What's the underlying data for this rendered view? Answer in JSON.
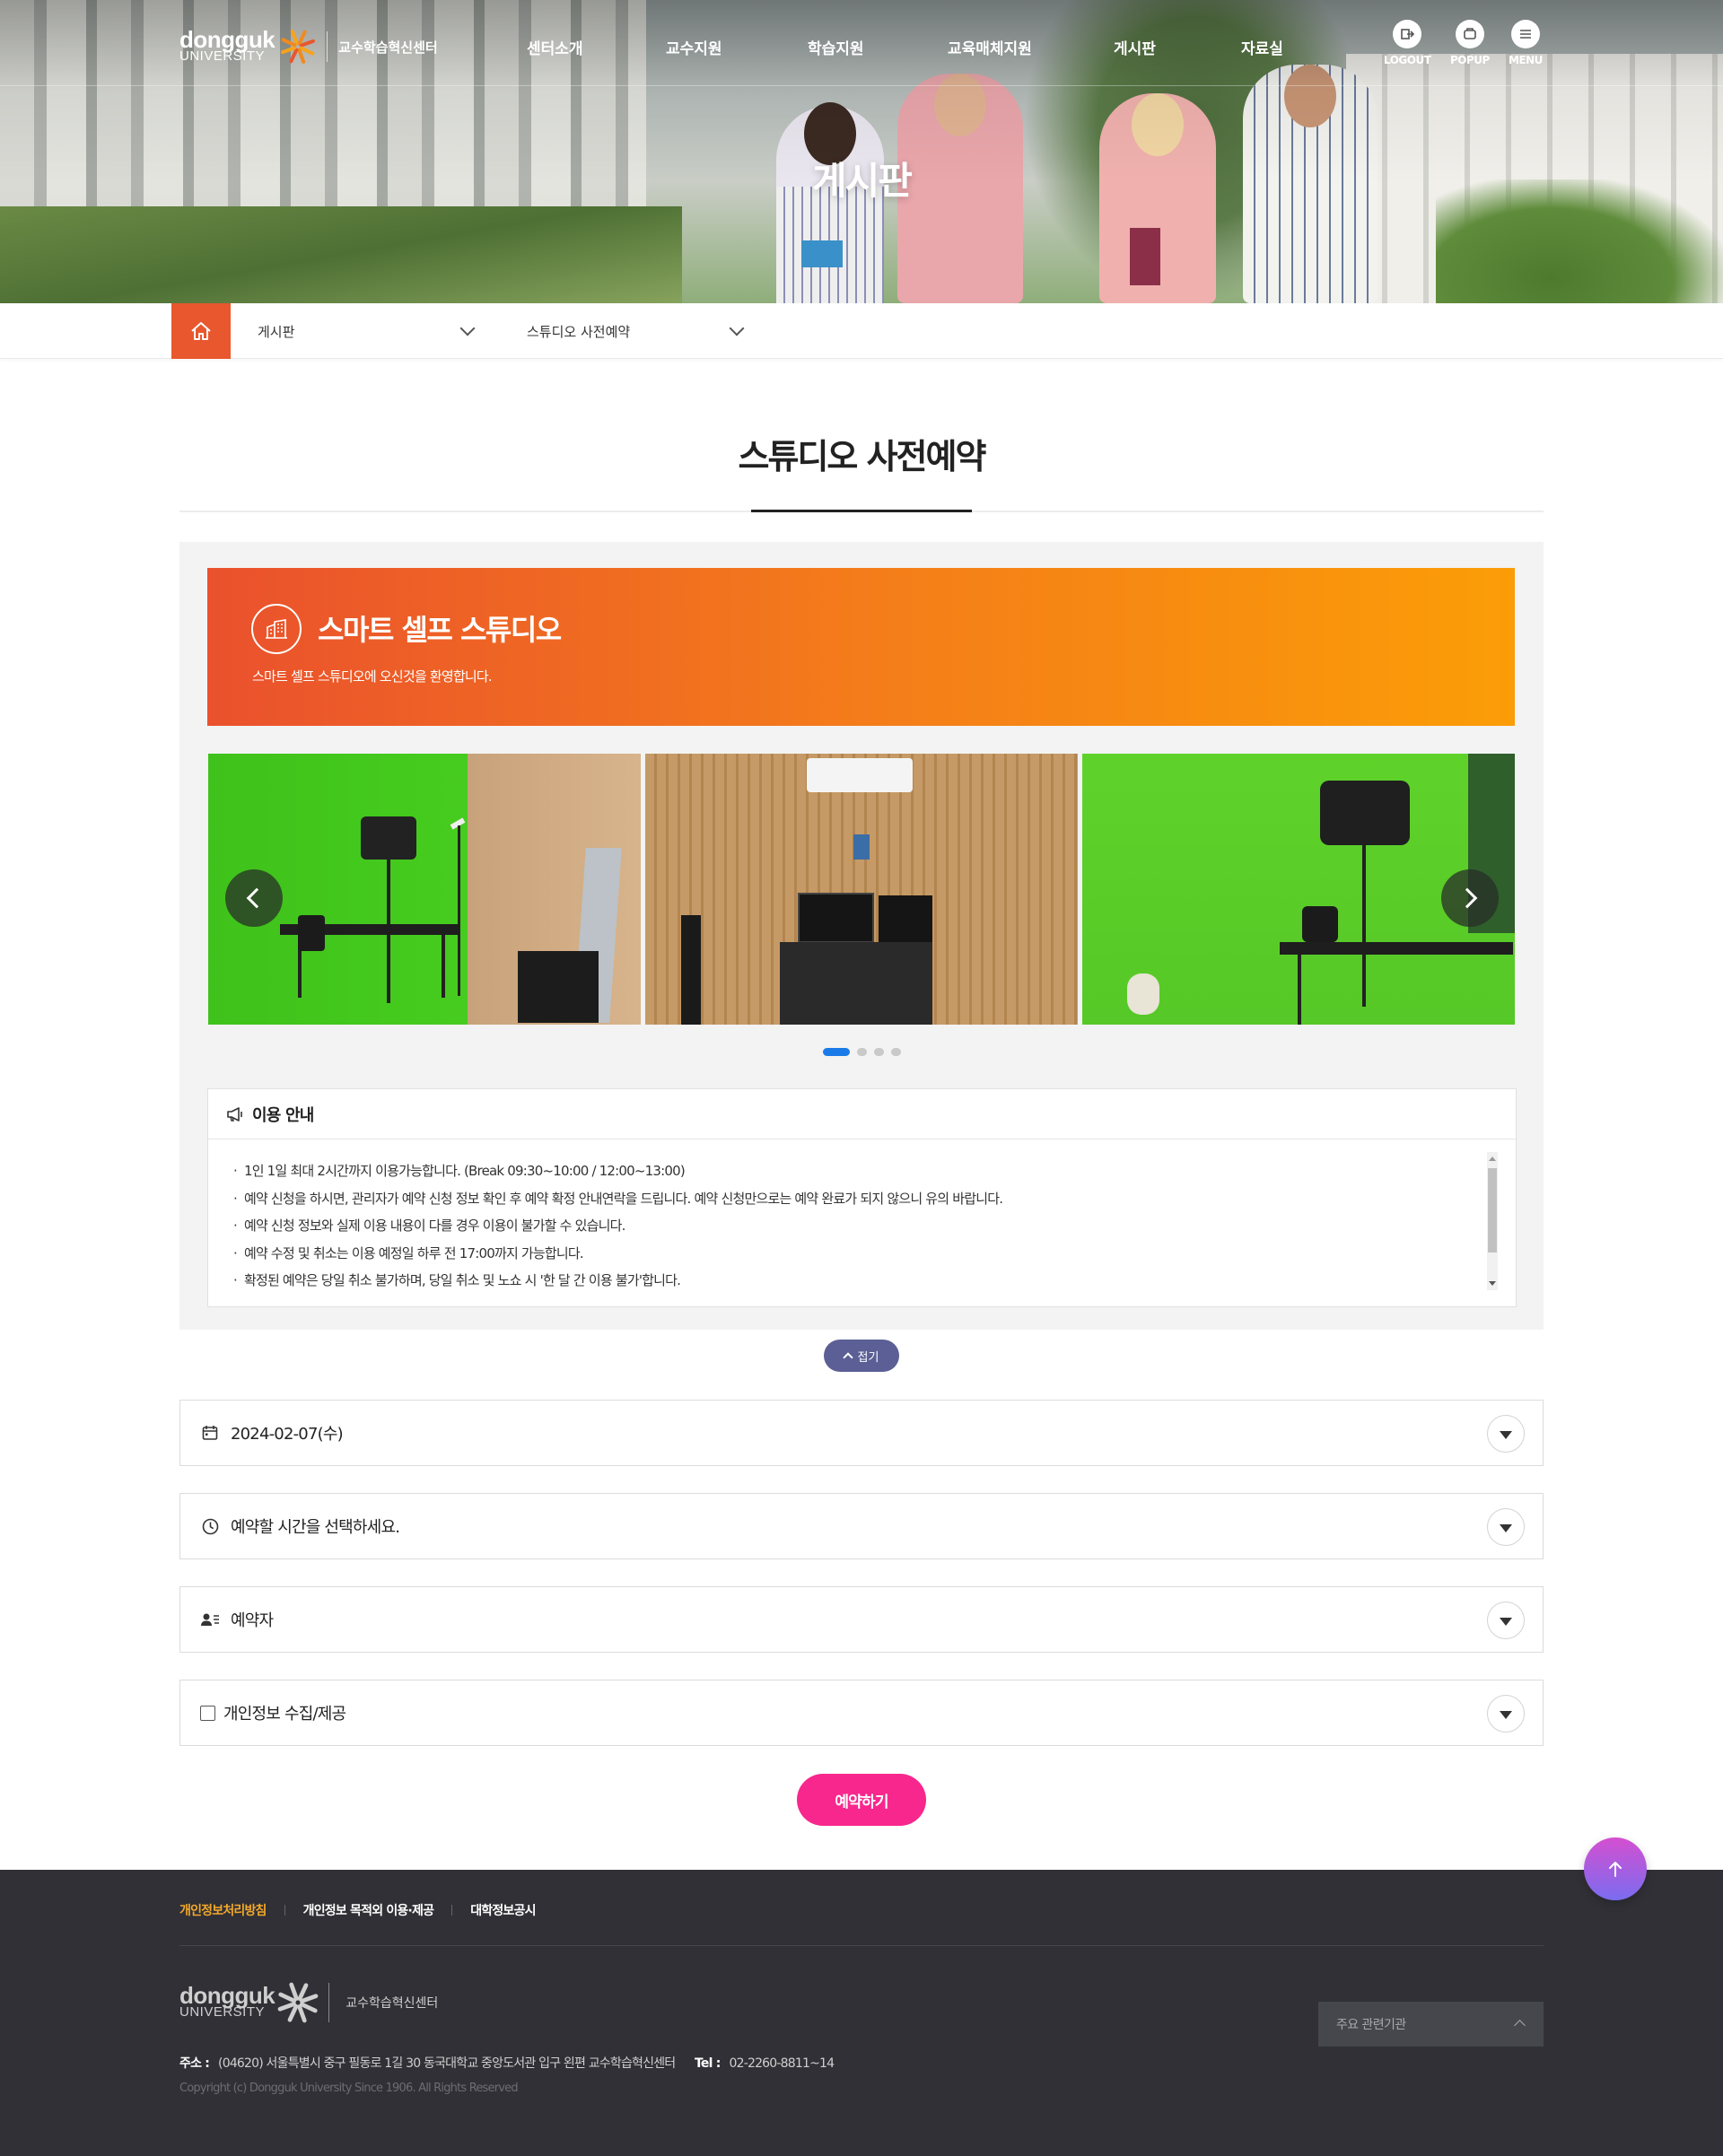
{
  "header": {
    "logo_word": "dongguk",
    "logo_sub": "UNIVERSITY",
    "center_name": "교수학습혁신센터",
    "nav": [
      "센터소개",
      "교수지원",
      "학습지원",
      "교육매체지원",
      "게시판",
      "자료실"
    ],
    "util": [
      {
        "label": "LOGOUT",
        "icon": "logout-icon"
      },
      {
        "label": "POPUP",
        "icon": "popup-icon"
      },
      {
        "label": "MENU",
        "icon": "menu-icon"
      }
    ]
  },
  "hero": {
    "title": "게시판"
  },
  "breadcrumb": {
    "home_icon": "home-icon",
    "level1": "게시판",
    "level2": "스튜디오 사전예약"
  },
  "page": {
    "title": "스튜디오 사전예약"
  },
  "banner": {
    "title": "스마트 셀프 스튜디오",
    "subtitle": "스마트 셀프 스튜디오에 오신것을 환영합니다.",
    "icon": "building-icon",
    "colors": {
      "start": "#ea512d",
      "end": "#fb9d07"
    }
  },
  "slider": {
    "slide_count": 4,
    "active_index": 0
  },
  "notice": {
    "title": "이용 안내",
    "icon": "megaphone-icon",
    "items": [
      "1인 1일 최대 2시간까지 이용가능합니다. (Break 09:30~10:00 / 12:00~13:00)",
      "예약 신청을 하시면, 관리자가 예약 신청 정보 확인 후 예약 확정 안내연락을 드립니다. 예약 신청만으로는 예약 완료가 되지 않으니 유의 바랍니다.",
      "예약 신청 정보와 실제 이용 내용이 다를 경우 이용이 불가할 수 있습니다.",
      "예약 수정 및 취소는 이용 예정일 하루 전 17:00까지 가능합니다.",
      "확정된 예약은 당일 취소 불가하며, 당일 취소 및 노쇼 시 '한 달 간 이용 불가'합니다."
    ]
  },
  "fold_label": "접기",
  "form": {
    "date": "2024-02-07(수)",
    "time_placeholder": "예약할 시간을 선택하세요.",
    "reserver_label": "예약자",
    "privacy_label": "개인정보 수집/제공",
    "submit_label": "예약하기"
  },
  "colors": {
    "accent": "#e8572e",
    "submit": "#f8278d",
    "fold": "#5b5f95",
    "footer_bg": "#303036",
    "footer_highlight": "#f3a82b"
  },
  "footer": {
    "links": [
      "개인정보처리방침",
      "개인정보 목적외 이용·제공",
      "대학정보공시"
    ],
    "logo_word": "dongguk",
    "logo_sub": "UNIVERSITY",
    "center_name": "교수학습혁신센터",
    "address_label": "주소 :",
    "address": "(04620) 서울특별시 중구 필동로 1길 30 동국대학교 중앙도서관 입구 왼편 교수학습혁신센터",
    "tel_label": "Tel :",
    "tel": "02-2260-8811~14",
    "copyright": "Copyright (c) Dongguk University Since 1906. All Rights Reserved",
    "related_label": "주요 관련기관"
  }
}
